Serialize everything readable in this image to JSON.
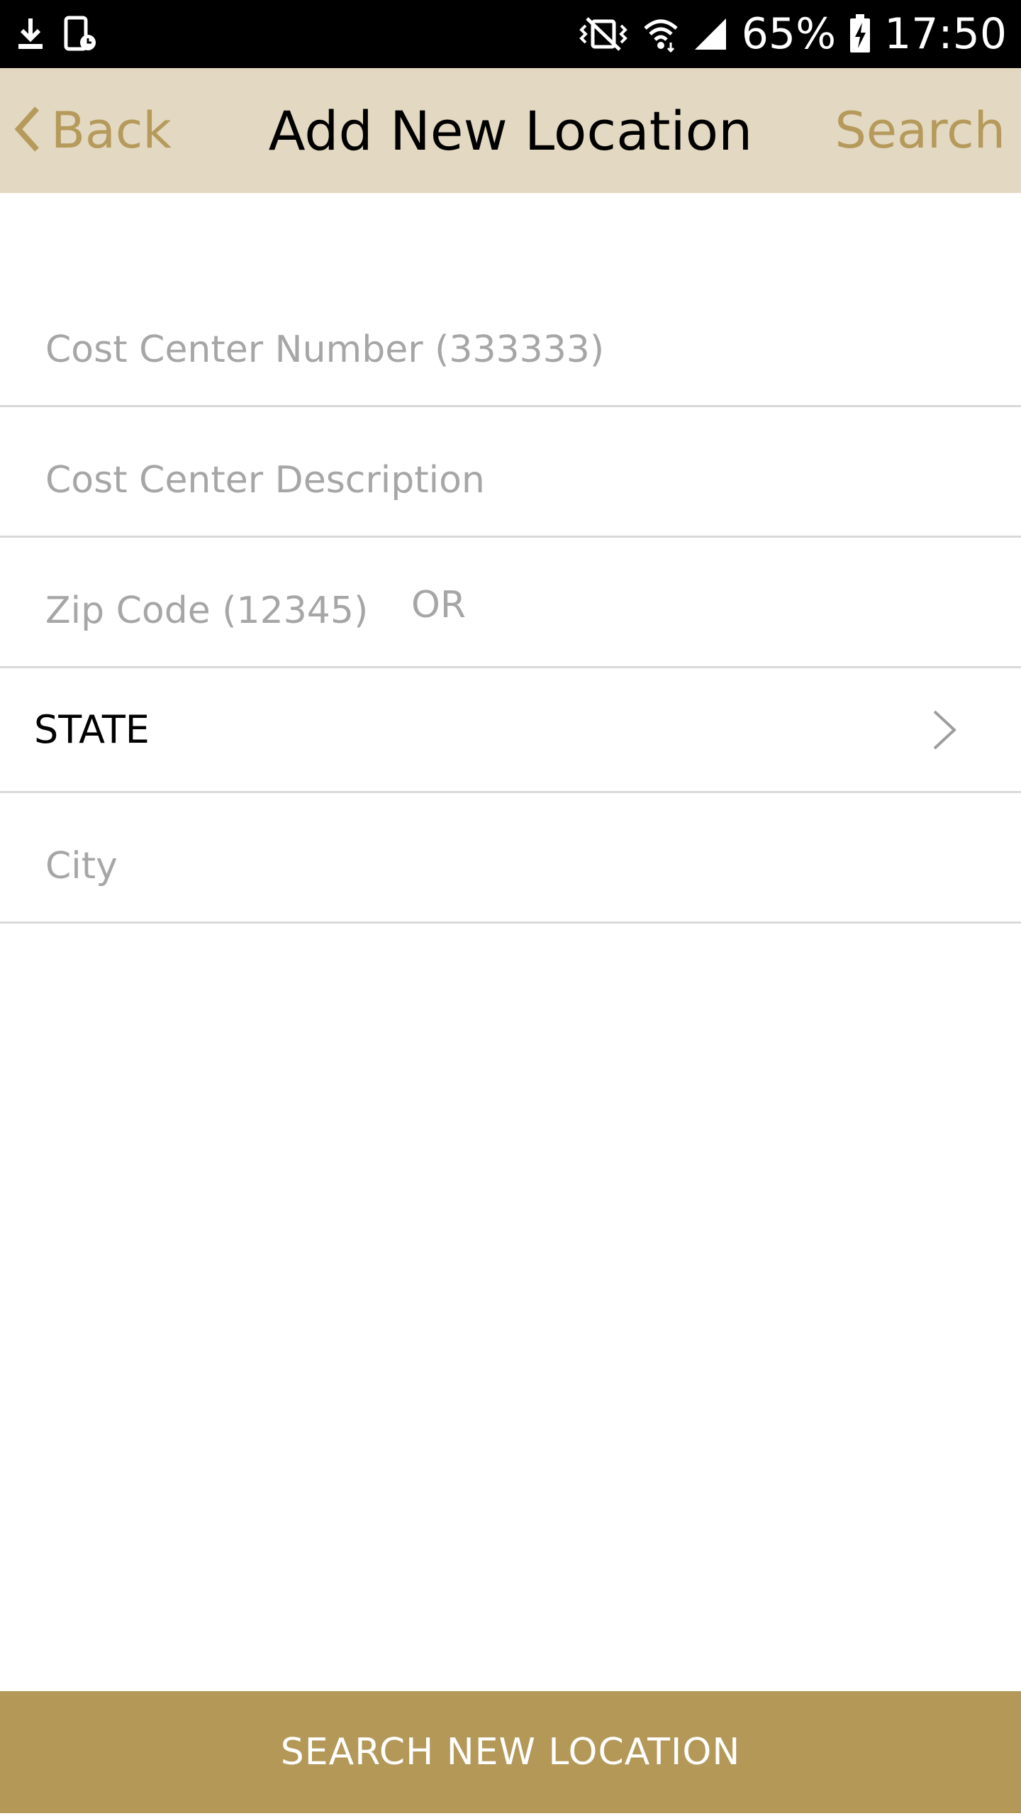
{
  "status_bar": {
    "battery": "65%",
    "time": "17:50",
    "icons": [
      "download-icon",
      "screen-timer-icon",
      "vibrate-mute-icon",
      "wifi-icon",
      "signal-icon",
      "battery-charging-icon"
    ]
  },
  "nav": {
    "back_label": "Back",
    "title": "Add New Location",
    "search_label": "Search",
    "background_color": "#e3d8c1",
    "accent_color": "#b59a5c"
  },
  "form": {
    "cost_center_number": {
      "value": "",
      "placeholder": "Cost Center Number (333333)"
    },
    "cost_center_description": {
      "value": "",
      "placeholder": "Cost Center Description"
    },
    "zip_code": {
      "value": "",
      "placeholder": "Zip Code (12345)"
    },
    "or_label": "OR",
    "state_label": "STATE",
    "city": {
      "value": "",
      "placeholder": "City"
    }
  },
  "footer": {
    "button_label": "SEARCH NEW LOCATION",
    "button_color": "#b39858"
  }
}
